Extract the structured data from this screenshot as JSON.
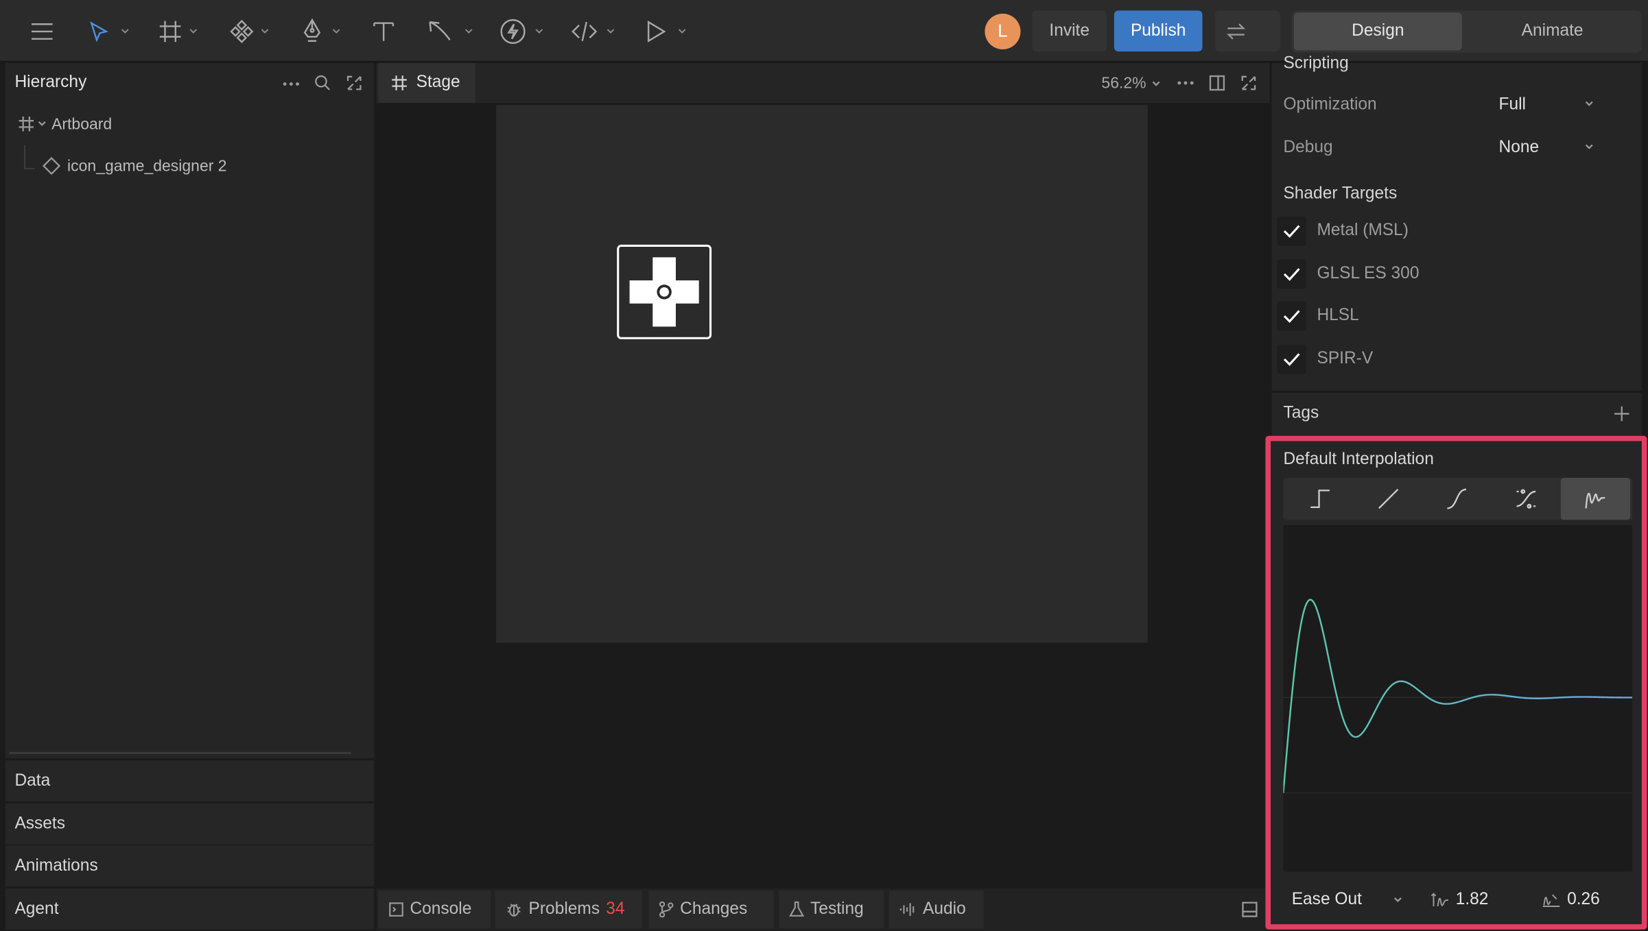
{
  "toolbar": {
    "avatar_initial": "L",
    "invite_label": "Invite",
    "publish_label": "Publish",
    "modes": {
      "design": "Design",
      "animate": "Animate"
    },
    "tools": [
      "menu-icon",
      "select-icon",
      "frame-icon",
      "component-icon",
      "pen-icon",
      "text-icon",
      "shape-icon",
      "event-icon",
      "code-icon",
      "play-icon"
    ]
  },
  "hierarchy": {
    "title": "Hierarchy",
    "artboard_label": "Artboard",
    "layer_label": "icon_game_designer 2"
  },
  "side_sections": [
    "Data",
    "Assets",
    "Animations",
    "Agent"
  ],
  "stage": {
    "tab_label": "Stage",
    "zoom": "56.2%"
  },
  "bottom_tabs": {
    "console": "Console",
    "problems": "Problems",
    "problems_count": "34",
    "changes": "Changes",
    "testing": "Testing",
    "audio": "Audio"
  },
  "inspector": {
    "section_scripting": "Scripting",
    "optimization_label": "Optimization",
    "optimization_value": "Full",
    "debug_label": "Debug",
    "debug_value": "None",
    "shader_targets_title": "Shader Targets",
    "shader_targets": [
      {
        "label": "Metal (MSL)",
        "checked": true
      },
      {
        "label": "GLSL ES 300",
        "checked": true
      },
      {
        "label": "HLSL",
        "checked": true
      },
      {
        "label": "SPIR-V",
        "checked": true
      }
    ],
    "tags_title": "Tags"
  },
  "interpolation": {
    "title": "Default Interpolation",
    "types": [
      "hold",
      "linear",
      "cubic",
      "cubic-value",
      "elastic"
    ],
    "active_type": "elastic",
    "easing": "Ease Out",
    "amplitude": "1.82",
    "period": "0.26",
    "highlight_color": "#e23e64"
  }
}
